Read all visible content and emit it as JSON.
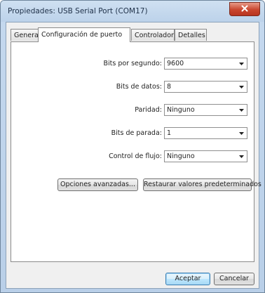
{
  "window": {
    "title": "Propiedades: USB Serial Port (COM17)"
  },
  "tabs": [
    {
      "label": "General"
    },
    {
      "label": "Configuración de puerto"
    },
    {
      "label": "Controlador"
    },
    {
      "label": "Detalles"
    }
  ],
  "fields": [
    {
      "label": "Bits por segundo:",
      "value": "9600"
    },
    {
      "label": "Bits de datos:",
      "value": "8"
    },
    {
      "label": "Paridad:",
      "value": "Ninguno"
    },
    {
      "label": "Bits de parada:",
      "value": "1"
    },
    {
      "label": "Control de flujo:",
      "value": "Ninguno"
    }
  ],
  "buttons": {
    "advanced": "Opciones avanzadas...",
    "restore": "Restaurar valores predeterminados",
    "ok": "Aceptar",
    "cancel": "Cancelar"
  },
  "icons": {
    "close": "close-icon",
    "dropdown": "chevron-down-icon"
  },
  "colors": {
    "close_button": "#c9462e",
    "default_button_border": "#3c7fb1"
  }
}
